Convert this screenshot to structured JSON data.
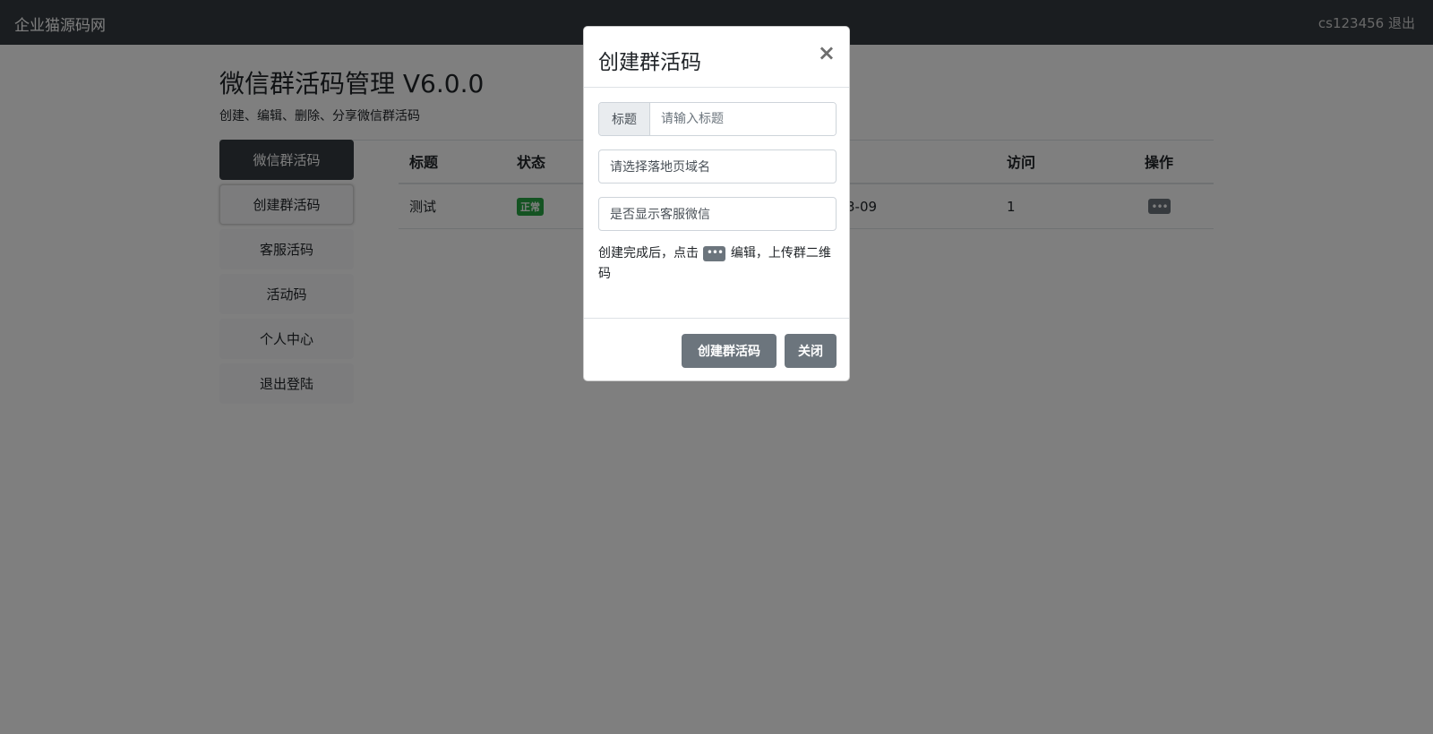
{
  "navbar": {
    "brand": "企业猫源码网",
    "user": "cs123456 退出"
  },
  "page": {
    "title": "微信群活码管理 V6.0.0",
    "subtitle": "创建、编辑、删除、分享微信群活码"
  },
  "sidebar": {
    "items": [
      {
        "label": "微信群活码",
        "state": "active"
      },
      {
        "label": "创建群活码",
        "state": "focused"
      },
      {
        "label": "客服活码",
        "state": "normal"
      },
      {
        "label": "活动码",
        "state": "normal"
      },
      {
        "label": "个人中心",
        "state": "normal"
      },
      {
        "label": "退出登陆",
        "state": "normal"
      }
    ]
  },
  "table": {
    "headers": {
      "title": "标题",
      "status": "状态",
      "visits": "访问",
      "actions": "操作"
    },
    "rows": [
      {
        "title": "测试",
        "status": "正常",
        "date_fragment": "3-09",
        "visits": "1",
        "action_icon": "more-dots-icon"
      }
    ]
  },
  "modal": {
    "title": "创建群活码",
    "close": "×",
    "title_field": {
      "label": "标题",
      "placeholder": "请输入标题"
    },
    "domain_select": {
      "value": "请选择落地页域名"
    },
    "kefu_select": {
      "value": "是否显示客服微信"
    },
    "hint": {
      "before": "创建完成后，点击",
      "icon": "•••",
      "after": "编辑，上传群二维码"
    },
    "buttons": {
      "create": "创建群活码",
      "close": "关闭"
    }
  },
  "colors": {
    "navbar": "#343a40",
    "active_item": "#343a40",
    "badge_success": "#28a745",
    "secondary_button": "#6c757d",
    "overlay": "rgba(0,0,0,0.5)"
  }
}
